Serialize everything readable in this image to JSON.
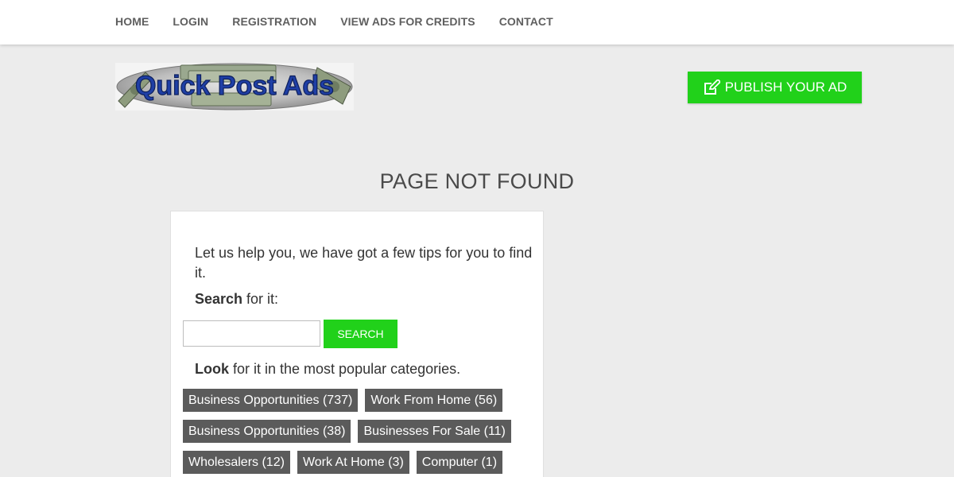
{
  "nav": {
    "items": [
      {
        "label": "HOME"
      },
      {
        "label": "LOGIN"
      },
      {
        "label": "REGISTRATION"
      },
      {
        "label": "VIEW ADS FOR CREDITS"
      },
      {
        "label": "CONTACT"
      }
    ]
  },
  "logo": {
    "text": "Quick Post Ads"
  },
  "header": {
    "publish_label": "PUBLISH YOUR AD"
  },
  "main": {
    "title": "PAGE NOT FOUND",
    "tips_text": "Let us help you, we have got a few tips for you to find it.",
    "search_bold": "Search",
    "search_rest": " for it:",
    "search_input_value": "",
    "search_button": "SEARCH",
    "look_bold": "Look",
    "look_rest": " for it in the most popular categories.",
    "categories": [
      {
        "label": "Business Opportunities (737)"
      },
      {
        "label": "Work From Home (56)"
      },
      {
        "label": "Business Opportunities (38)"
      },
      {
        "label": "Businesses For Sale (11)"
      },
      {
        "label": "Wholesalers (12)"
      },
      {
        "label": "Work At Home (3)"
      },
      {
        "label": "Computer (1)"
      }
    ]
  },
  "colors": {
    "accent_green": "#21d11a",
    "tag_gray": "#5b5b5b",
    "background": "#ececec"
  },
  "icons": {
    "publish": "edit-icon"
  }
}
